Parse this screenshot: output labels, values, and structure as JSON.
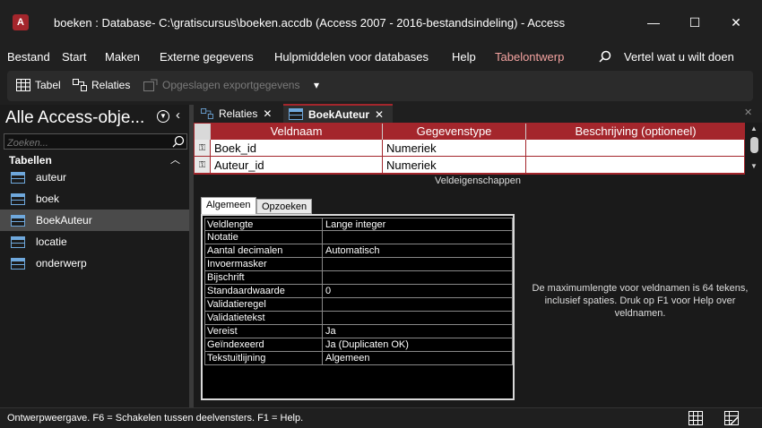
{
  "window": {
    "title": "boeken : Database- C:\\gratiscursus\\boeken.accdb (Access 2007 - 2016-bestandsindeling)  -  Access",
    "app_icon_letter": "A",
    "minimize": "—",
    "maximize": "☐",
    "close": "✕"
  },
  "menu": {
    "items": [
      "Bestand",
      "Start",
      "Maken",
      "Externe gegevens",
      "Hulpmiddelen voor databases",
      "Help",
      "Tabelontwerp"
    ],
    "tell_me": "Vertel wat u wilt doen",
    "accent_color": "#f4a3a0"
  },
  "ribbon": {
    "tabel": "Tabel",
    "relaties": "Relaties",
    "exports": "Opgeslagen exportgegevens",
    "more": "▾"
  },
  "nav": {
    "title": "Alle Access-obje...",
    "search_placeholder": "Zoeken...",
    "section": "Tabellen",
    "items": [
      "auteur",
      "boek",
      "BoekAuteur",
      "locatie",
      "onderwerp"
    ],
    "selected": "BoekAuteur"
  },
  "tabs": {
    "items": [
      "Relaties",
      "BoekAuteur"
    ],
    "active": "BoekAuteur",
    "close": "✕"
  },
  "design_grid": {
    "headers": [
      "Veldnaam",
      "Gegevenstype",
      "Beschrijving (optioneel)"
    ],
    "rows": [
      {
        "name": "Boek_id",
        "type": "Numeriek",
        "description": ""
      },
      {
        "name": "Auteur_id",
        "type": "Numeriek",
        "description": ""
      }
    ]
  },
  "field_properties": {
    "label": "Veldeigenschappen",
    "tabs": [
      "Algemeen",
      "Opzoeken"
    ],
    "active_tab": "Algemeen",
    "rows": [
      {
        "key": "Veldlengte",
        "value": "Lange integer"
      },
      {
        "key": "Notatie",
        "value": ""
      },
      {
        "key": "Aantal decimalen",
        "value": "Automatisch"
      },
      {
        "key": "Invoermasker",
        "value": ""
      },
      {
        "key": "Bijschrift",
        "value": ""
      },
      {
        "key": "Standaardwaarde",
        "value": "0"
      },
      {
        "key": "Validatieregel",
        "value": ""
      },
      {
        "key": "Validatietekst",
        "value": ""
      },
      {
        "key": "Vereist",
        "value": "Ja"
      },
      {
        "key": "Geïndexeerd",
        "value": "Ja (Duplicaten OK)"
      },
      {
        "key": "Tekstuitlijning",
        "value": "Algemeen"
      }
    ],
    "help_text": "De maximumlengte voor veldnamen is 64 tekens, inclusief spaties. Druk op F1 voor Help over veldnamen."
  },
  "status": {
    "text": "Ontwerpweergave. F6 = Schakelen tussen deelvensters. F1 = Help."
  },
  "colors": {
    "accent": "#a4262c",
    "background": "#1f1f1f"
  }
}
